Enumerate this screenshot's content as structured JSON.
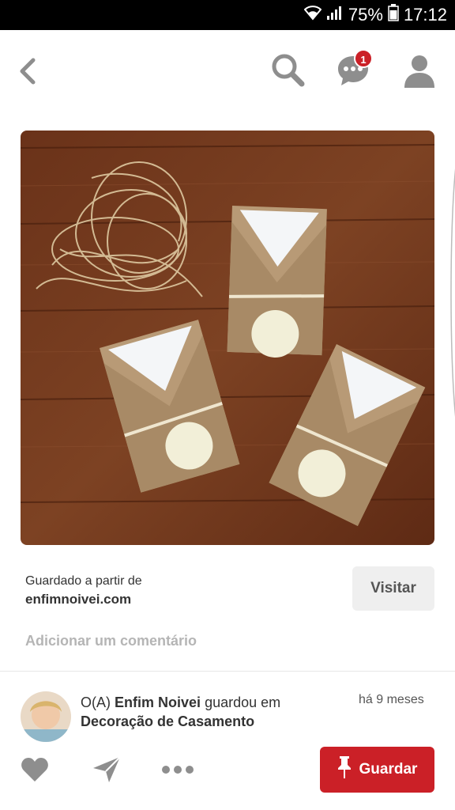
{
  "status_bar": {
    "battery": "75%",
    "time": "17:12"
  },
  "header": {
    "notification_count": "1"
  },
  "pin": {
    "saved_from_label": "Guardado a partir de",
    "source_domain": "enfimnoivei.com",
    "visit_label": "Visitar",
    "comment_placeholder": "Adicionar um comentário"
  },
  "activity": {
    "prefix": "O(A)",
    "user": "Enfim Noivei",
    "action": "guardou em",
    "board": "Decoração de Casamento",
    "time": "há 9 meses"
  },
  "actions": {
    "save_label": "Guardar"
  },
  "icons": [
    "wifi-icon",
    "signal-icon",
    "battery-icon",
    "back-icon",
    "search-icon",
    "chat-icon",
    "profile-icon",
    "heart-icon",
    "send-icon",
    "more-icon",
    "pin-icon"
  ],
  "colors": {
    "accent": "#cb2027",
    "icon_gray": "#8e8e8e",
    "button_gray": "#efefef"
  }
}
